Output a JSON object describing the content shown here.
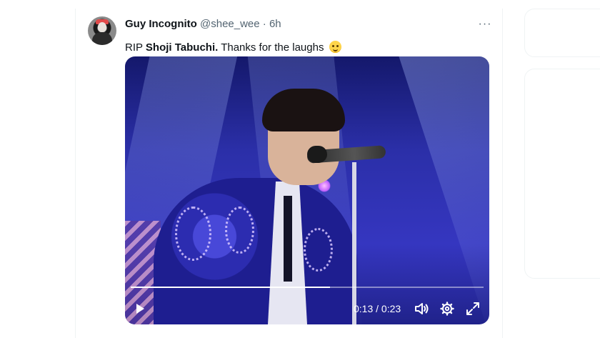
{
  "tweet": {
    "author": {
      "display_name": "Guy Incognito",
      "handle": "@shee_wee",
      "separator": "·",
      "time_ago": "6h"
    },
    "text_prefix": "RIP ",
    "text_bold": "Shoji Tabuchi.",
    "text_suffix": " Thanks for the laughs",
    "emoji": "smiling-face-with-tear",
    "more_options_glyph": "···"
  },
  "video": {
    "current_time": "0:13",
    "separator": "/",
    "duration": "0:23",
    "progress_fraction": 0.565,
    "controls": [
      "play-icon",
      "volume-icon",
      "gear-icon",
      "fullscreen-icon"
    ]
  },
  "colors": {
    "text_primary": "#0f1419",
    "text_secondary": "#536471",
    "border": "#eff3f4",
    "video_accent": "#2b2fa8"
  }
}
